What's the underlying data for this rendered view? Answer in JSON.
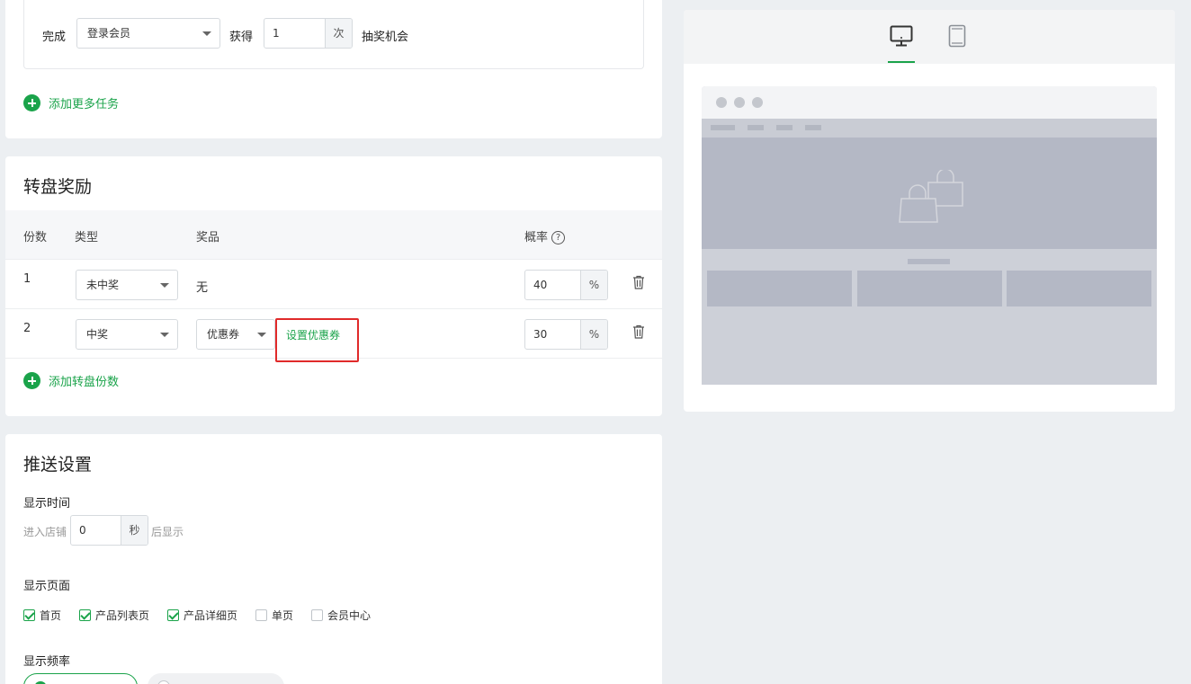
{
  "task": {
    "complete_label": "完成",
    "task_select": "登录会员",
    "obtain_label": "获得",
    "times_value": "1",
    "times_unit": "次",
    "chances_label": "抽奖机会",
    "add_task": "添加更多任务"
  },
  "wheel": {
    "title": "转盘奖励",
    "headers": {
      "count": "份数",
      "type": "类型",
      "prize": "奖品",
      "prob": "概率"
    },
    "rows": [
      {
        "index": "1",
        "type": "未中奖",
        "prize": "无",
        "prob": "40",
        "unit": "%"
      },
      {
        "index": "2",
        "type": "中奖",
        "prize_select": "优惠券",
        "set_link": "设置优惠券",
        "prob": "30",
        "unit": "%"
      }
    ],
    "add_portion": "添加转盘份数"
  },
  "push": {
    "title": "推送设置",
    "display_time_label": "显示时间",
    "enter_store": "进入店铺",
    "seconds_value": "0",
    "seconds_unit": "秒",
    "after_show": "后显示",
    "display_page_label": "显示页面",
    "pages": [
      {
        "label": "首页",
        "checked": true
      },
      {
        "label": "产品列表页",
        "checked": true
      },
      {
        "label": "产品详细页",
        "checked": true
      },
      {
        "label": "单页",
        "checked": false
      },
      {
        "label": "会员中心",
        "checked": false
      }
    ],
    "frequency_label": "显示频率"
  },
  "colors": {
    "accent": "#1aa34a",
    "highlight": "#e02a2a"
  },
  "preview": {
    "tabs": [
      {
        "icon": "desktop-icon",
        "active": true
      },
      {
        "icon": "tablet-icon",
        "active": false
      }
    ]
  }
}
